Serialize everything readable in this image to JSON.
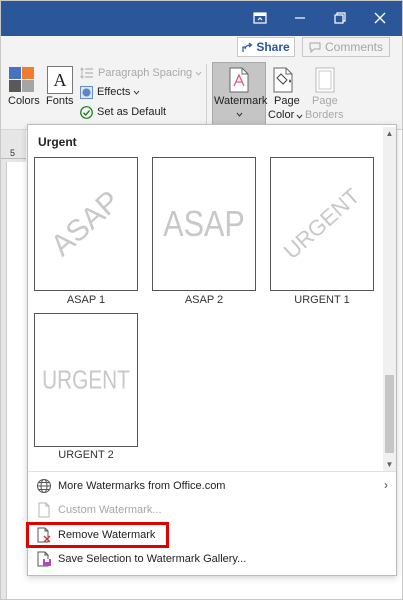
{
  "ribbon": {
    "share_label": "Share",
    "comments_label": "Comments",
    "colors_label": "Colors",
    "fonts_label": "Fonts",
    "paragraph_spacing_label": "Paragraph Spacing",
    "effects_label": "Effects",
    "set_default_label": "Set as Default",
    "watermark_label": "Watermark",
    "page_color_label": "Page Color",
    "page_color_line1": "Page",
    "page_color_line2": "Color",
    "page_borders_line1": "Page",
    "page_borders_line2": "Borders",
    "fonts_icon_letter": "A"
  },
  "ruler": {
    "number": "5"
  },
  "watermark_gallery": {
    "section_title": "Urgent",
    "items": [
      {
        "label": "ASAP 1",
        "text": "ASAP",
        "style": "diagonal"
      },
      {
        "label": "ASAP 2",
        "text": "ASAP",
        "style": "horizontal"
      },
      {
        "label": "URGENT 1",
        "text": "URGENT",
        "style": "diagonal"
      },
      {
        "label": "URGENT 2",
        "text": "URGENT",
        "style": "horizontal"
      }
    ]
  },
  "menu": {
    "more_watermarks": "More Watermarks from Office.com",
    "custom_watermark": "Custom Watermark...",
    "remove_watermark": "Remove Watermark",
    "save_selection": "Save Selection to Watermark Gallery..."
  },
  "colors": {
    "titlebar": "#2b579a",
    "highlight": "#e00000",
    "watermark_text": "#c8c8c8"
  }
}
